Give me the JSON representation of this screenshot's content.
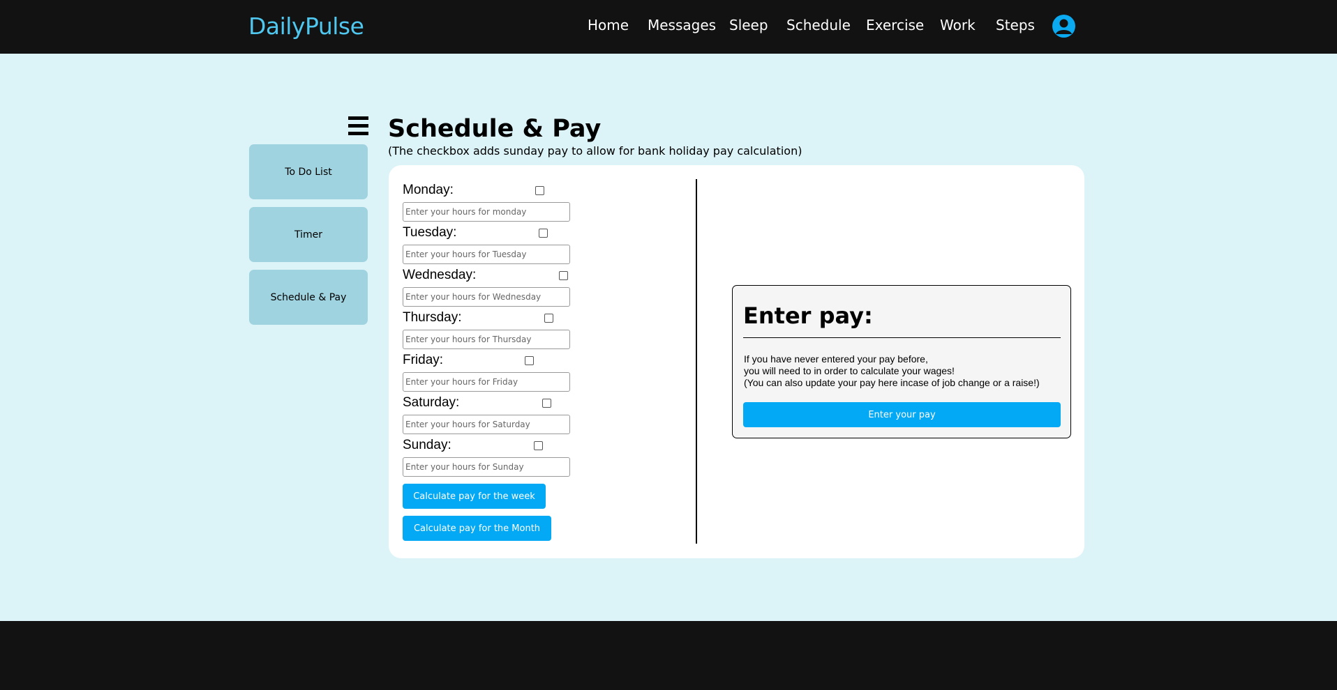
{
  "header": {
    "brand": "DailyPulse",
    "nav": [
      "Home",
      "Messages",
      "Sleep",
      "Schedule",
      "Exercise",
      "Work",
      "Steps"
    ],
    "profile_icon": "user-circle-icon"
  },
  "sidebar": {
    "menu_icon": "hamburger-icon",
    "items": [
      "To Do List",
      "Timer",
      "Schedule & Pay"
    ]
  },
  "main": {
    "title": "Schedule & Pay",
    "subtitle": "(The checkbox adds sunday pay to allow for bank holiday pay calculation)",
    "days": [
      {
        "label": "Monday:",
        "placeholder": "Enter your hours for monday",
        "checked": false
      },
      {
        "label": "Tuesday:",
        "placeholder": "Enter your hours for Tuesday",
        "checked": false
      },
      {
        "label": "Wednesday:",
        "placeholder": "Enter your hours for Wednesday",
        "checked": false
      },
      {
        "label": "Thursday:",
        "placeholder": "Enter your hours for Thursday",
        "checked": false
      },
      {
        "label": "Friday:",
        "placeholder": "Enter your hours for Friday",
        "checked": false
      },
      {
        "label": "Saturday:",
        "placeholder": "Enter your hours for Saturday",
        "checked": false
      },
      {
        "label": "Sunday:",
        "placeholder": "Enter your hours for Sunday",
        "checked": false
      }
    ],
    "calc_week_label": "Calculate pay for the week",
    "calc_month_label": "Calculate pay for the Month"
  },
  "pay_panel": {
    "title": "Enter pay:",
    "lines": [
      "If you have never entered your pay before,",
      "you will need to in order to calculate your wages!",
      "(You can also update your pay here incase of job change or a raise!)"
    ],
    "button_label": "Enter your pay"
  },
  "colors": {
    "accent": "#03a9f4",
    "brand": "#4fc7ef",
    "background": "#dcf4f8",
    "sidebar_button": "#a0d3e0",
    "bars": "#121212"
  }
}
